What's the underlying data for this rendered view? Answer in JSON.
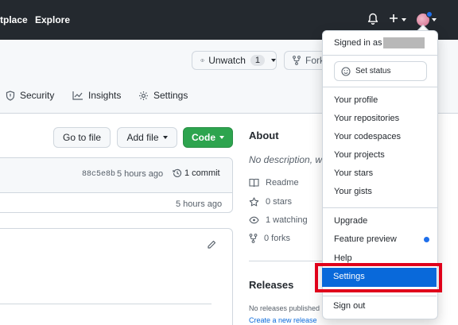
{
  "header": {
    "nav": [
      "tplace",
      "Explore"
    ],
    "icons": [
      "bell-icon",
      "plus-icon",
      "avatar"
    ]
  },
  "repo": {
    "unwatch_label": "Unwatch",
    "unwatch_count": "1",
    "fork_label": "Fork",
    "tabs": [
      {
        "label": "Security",
        "icon": "shield-icon"
      },
      {
        "label": "Insights",
        "icon": "graph-icon"
      },
      {
        "label": "Settings",
        "icon": "gear-icon"
      }
    ],
    "buttons": {
      "go_to_file": "Go to file",
      "add_file": "Add file",
      "code": "Code"
    },
    "commit": {
      "sha": "88c5e8b",
      "time": "5 hours ago",
      "count": "1 commit"
    },
    "file_row_time": "5 hours ago"
  },
  "about": {
    "title": "About",
    "description": "No description, w",
    "readme": "Readme",
    "stars": "0 stars",
    "watching": "1 watching",
    "forks": "0 forks",
    "releases_title": "Releases",
    "releases_text": "No releases published",
    "create_release": "Create a new release"
  },
  "dropdown": {
    "signed_in_as": "Signed in as",
    "set_status": "Set status",
    "items_group1": [
      "Your profile",
      "Your repositories",
      "Your codespaces",
      "Your projects",
      "Your stars",
      "Your gists"
    ],
    "upgrade": "Upgrade",
    "feature_preview": "Feature preview",
    "help": "Help",
    "settings": "Settings",
    "sign_out": "Sign out"
  },
  "colors": {
    "header_bg": "#24292f",
    "code_button": "#2da44e",
    "settings_highlight": "#0969da",
    "annotation_box": "#e0001b"
  }
}
